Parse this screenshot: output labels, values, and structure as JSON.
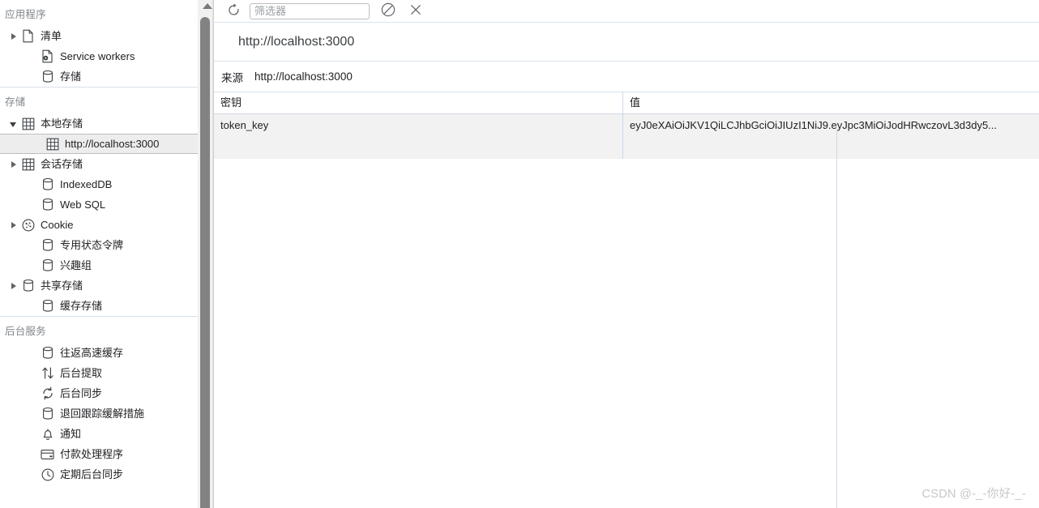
{
  "sidebar": {
    "sections": [
      {
        "title": "应用程序",
        "items": [
          {
            "label": "清单",
            "icon": "document-icon",
            "twisty": "closed",
            "indent": 1,
            "selected": false
          },
          {
            "label": "Service workers",
            "icon": "service-worker-icon",
            "twisty": "none",
            "indent": 2,
            "selected": false
          },
          {
            "label": "存储",
            "icon": "database-icon",
            "twisty": "none",
            "indent": 2,
            "selected": false
          }
        ]
      },
      {
        "title": "存储",
        "items": [
          {
            "label": "本地存储",
            "icon": "grid-icon",
            "twisty": "open",
            "indent": 1,
            "selected": false
          },
          {
            "label": "http://localhost:3000",
            "icon": "grid-icon",
            "twisty": "none",
            "indent": 3,
            "selected": true
          },
          {
            "label": "会话存储",
            "icon": "grid-icon",
            "twisty": "closed",
            "indent": 1,
            "selected": false
          },
          {
            "label": "IndexedDB",
            "icon": "database-icon",
            "twisty": "none",
            "indent": 2,
            "selected": false
          },
          {
            "label": "Web SQL",
            "icon": "database-icon",
            "twisty": "none",
            "indent": 2,
            "selected": false
          },
          {
            "label": "Cookie",
            "icon": "cookie-icon",
            "twisty": "closed",
            "indent": 1,
            "selected": false
          },
          {
            "label": "专用状态令牌",
            "icon": "database-icon",
            "twisty": "none",
            "indent": 2,
            "selected": false
          },
          {
            "label": "兴趣组",
            "icon": "database-icon",
            "twisty": "none",
            "indent": 2,
            "selected": false
          },
          {
            "label": "共享存储",
            "icon": "database-icon",
            "twisty": "closed",
            "indent": 1,
            "selected": false
          },
          {
            "label": "缓存存储",
            "icon": "database-icon",
            "twisty": "none",
            "indent": 2,
            "selected": false
          }
        ]
      },
      {
        "title": "后台服务",
        "items": [
          {
            "label": "往返高速缓存",
            "icon": "database-icon",
            "twisty": "none",
            "indent": 2,
            "selected": false
          },
          {
            "label": "后台提取",
            "icon": "arrows-up-down-icon",
            "twisty": "none",
            "indent": 2,
            "selected": false
          },
          {
            "label": "后台同步",
            "icon": "sync-icon",
            "twisty": "none",
            "indent": 2,
            "selected": false
          },
          {
            "label": "退回跟踪缓解措施",
            "icon": "database-icon",
            "twisty": "none",
            "indent": 2,
            "selected": false
          },
          {
            "label": "通知",
            "icon": "bell-icon",
            "twisty": "none",
            "indent": 2,
            "selected": false
          },
          {
            "label": "付款处理程序",
            "icon": "credit-card-icon",
            "twisty": "none",
            "indent": 2,
            "selected": false
          },
          {
            "label": "定期后台同步",
            "icon": "clock-icon",
            "twisty": "none",
            "indent": 2,
            "selected": false
          }
        ]
      }
    ]
  },
  "toolbar": {
    "refresh_icon": "refresh-icon",
    "filter_placeholder": "筛选器",
    "filter_value": "",
    "clear_icon": "clear-icon",
    "close_icon": "close-icon"
  },
  "header": {
    "url": "http://localhost:3000"
  },
  "origin": {
    "label": "来源",
    "value": "http://localhost:3000"
  },
  "table": {
    "columns": [
      "密钥",
      "值"
    ],
    "rows": [
      {
        "key": "token_key",
        "value": "eyJ0eXAiOiJKV1QiLCJhbGciOiJIUzI1NiJ9.eyJpc3MiOiJodHRwczovL3d3dy5..."
      }
    ]
  },
  "watermark": {
    "text": "CSDN @-_-你好-_-"
  },
  "colors": {
    "accent": "#1a73e8",
    "selection": "#ededed",
    "row": "#f2f2f2",
    "border": "#cfd8e3",
    "muted": "#80868b",
    "scrollbar": "#828282"
  }
}
